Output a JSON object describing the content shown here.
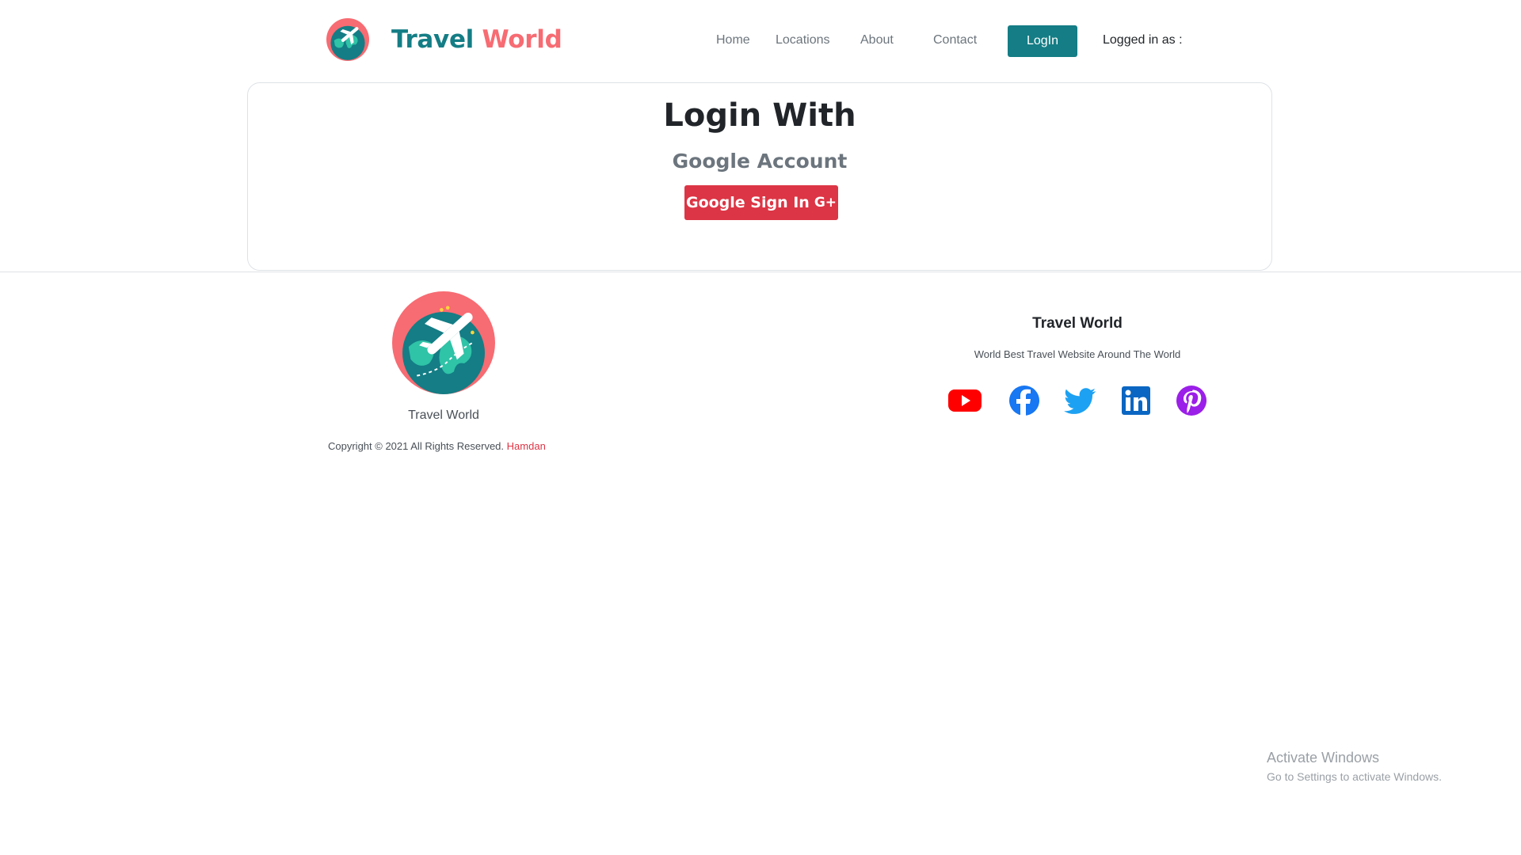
{
  "navbar": {
    "brand_part1": "Travel",
    "brand_part2": "World",
    "brand_logo_icon": "globe-airplane-icon",
    "links": [
      "Home",
      "Locations",
      "About",
      "Contact"
    ],
    "login_label": "LogIn",
    "logged_in_label": "Logged in as :"
  },
  "login_card": {
    "title": "Login With",
    "subtitle": "Google Account",
    "google_button_label": "Google Sign In",
    "google_button_icon_text": "G+"
  },
  "footer": {
    "logo_icon": "globe-airplane-icon",
    "brand_name": "Travel World",
    "copyright_text": "Copyright © 2021 All Rights Reserved.",
    "copyright_author": "Hamdan",
    "right_title": "Travel World",
    "tagline": "World Best Travel Website Around The World",
    "social_icons": [
      "youtube-icon",
      "facebook-icon",
      "twitter-icon",
      "linkedin-icon",
      "pinterest-icon"
    ]
  },
  "watermark": {
    "line1": "Activate Windows",
    "line2": "Go to Settings to activate Windows."
  },
  "colors": {
    "brand_teal": "#147d85",
    "brand_coral": "#f76b72",
    "danger_red": "#dc3545",
    "youtube": "#ff0000",
    "facebook": "#1877f2",
    "twitter": "#1da1f2",
    "linkedin": "#0a66c2",
    "pinterest": "#9b1fe8"
  }
}
